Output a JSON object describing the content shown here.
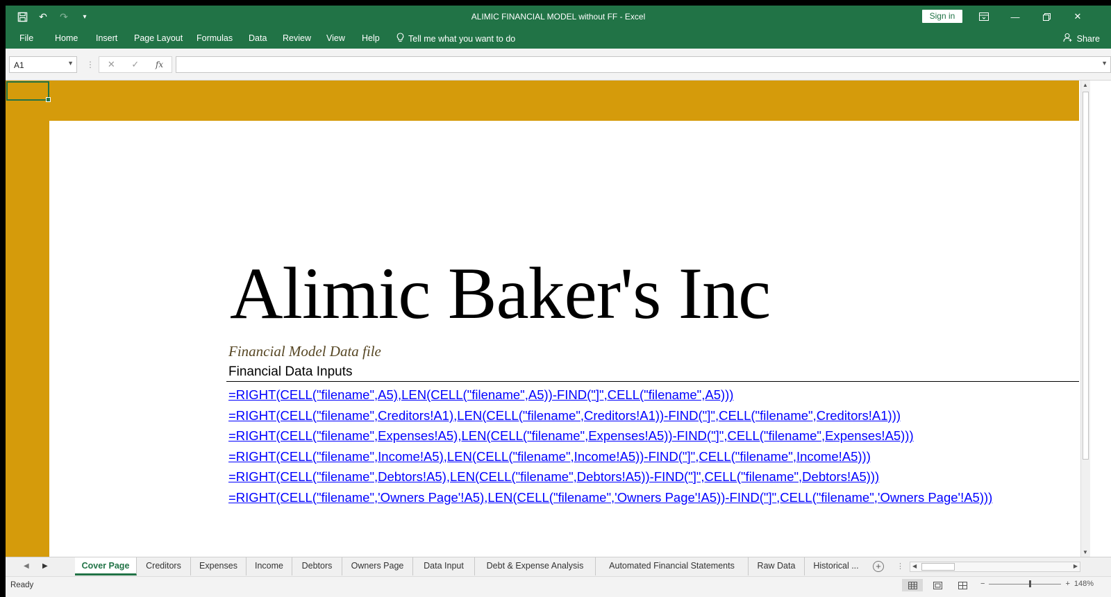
{
  "window": {
    "title": "ALIMIC FINANCIAL MODEL without FF  -  Excel",
    "sign_in": "Sign in"
  },
  "ribbon": {
    "tabs": [
      "File",
      "Home",
      "Insert",
      "Page Layout",
      "Formulas",
      "Data",
      "Review",
      "View",
      "Help"
    ],
    "tell_me": "Tell me what you want to do",
    "share": "Share"
  },
  "formula_bar": {
    "name_box": "A1",
    "formula": ""
  },
  "sheet": {
    "fill_color": "#d59b0b",
    "company": "Alimic Baker's Inc",
    "subtitle": "Financial Model Data file",
    "inputs_heading": "Financial Data Inputs",
    "links": [
      "=RIGHT(CELL(\"filename\",A5),LEN(CELL(\"filename\",A5))-FIND(\"]\",CELL(\"filename\",A5)))",
      "=RIGHT(CELL(\"filename\",Creditors!A1),LEN(CELL(\"filename\",Creditors!A1))-FIND(\"]\",CELL(\"filename\",Creditors!A1)))",
      "=RIGHT(CELL(\"filename\",Expenses!A5),LEN(CELL(\"filename\",Expenses!A5))-FIND(\"]\",CELL(\"filename\",Expenses!A5)))",
      "=RIGHT(CELL(\"filename\",Income!A5),LEN(CELL(\"filename\",Income!A5))-FIND(\"]\",CELL(\"filename\",Income!A5)))",
      "=RIGHT(CELL(\"filename\",Debtors!A5),LEN(CELL(\"filename\",Debtors!A5))-FIND(\"]\",CELL(\"filename\",Debtors!A5)))",
      "=RIGHT(CELL(\"filename\",'Owners Page'!A5),LEN(CELL(\"filename\",'Owners Page'!A5))-FIND(\"]\",CELL(\"filename\",'Owners Page'!A5)))"
    ]
  },
  "sheet_tabs": {
    "active": "Cover Page",
    "tabs": [
      "Cover Page",
      "Creditors",
      "Expenses",
      "Income",
      "Debtors",
      "Owners Page",
      "Data Input",
      "Debt & Expense Analysis",
      "Automated Financial Statements",
      "Raw Data",
      "Historical ..."
    ]
  },
  "status_bar": {
    "ready": "Ready",
    "zoom": "148%"
  }
}
